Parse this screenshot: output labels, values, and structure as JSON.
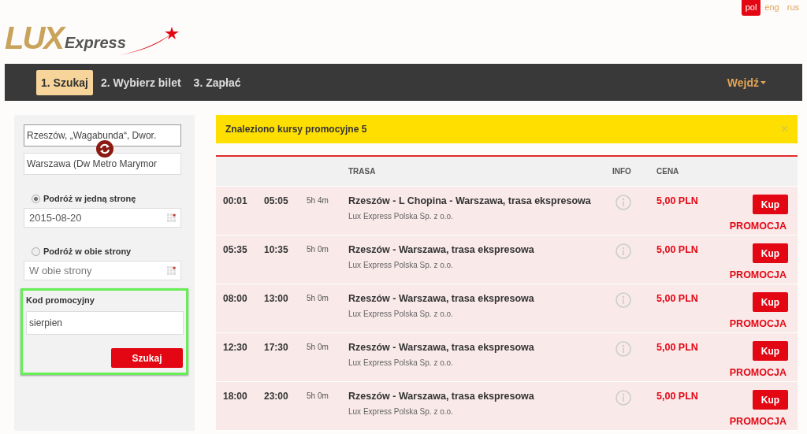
{
  "languages": [
    {
      "label": "pol",
      "selected": true
    },
    {
      "label": "eng",
      "selected": false
    },
    {
      "label": "rus",
      "selected": false
    }
  ],
  "logo": {
    "word": "LUX",
    "subword": "Express"
  },
  "steps": [
    {
      "label": "1. Szukaj",
      "selected": true
    },
    {
      "label": "2. Wybierz bilet",
      "selected": false
    },
    {
      "label": "3. Zapłać",
      "selected": false
    }
  ],
  "login": {
    "label": "Wejdź"
  },
  "search": {
    "from": "Rzeszów, „Wagabunda“, Dwor.",
    "to": "Warszawa (Dw Metro Marymor",
    "trip_types": [
      {
        "label": "Podróż w jedną stronę",
        "selected": true,
        "date_value": "2015-08-20"
      },
      {
        "label": "Podróż w obie strony",
        "selected": false,
        "date_placeholder": "W obie strony"
      }
    ],
    "promo": {
      "label": "Kod promocyjny",
      "value": "sierpien"
    },
    "button": "Szukaj"
  },
  "alert": {
    "text": "Znaleziono kursy promocyjne 5",
    "close": "×"
  },
  "table": {
    "columns": [
      "TRASA",
      "INFO",
      "CENA"
    ],
    "rows": [
      {
        "departure": "00:01",
        "arrival": "05:05",
        "duration": "5h 4m",
        "route": "Rzeszów - L Chopina - Warszawa, trasa ekspresowa",
        "operator": "Lux Express Polska Sp. z o.o.",
        "price": "5,00 PLN",
        "button": "Kup",
        "tag": "PROMOCJA"
      },
      {
        "departure": "05:35",
        "arrival": "10:35",
        "duration": "5h 0m",
        "route": "Rzeszów - Warszawa, trasa ekspresowa",
        "operator": "Lux Express Polska Sp. z o.o.",
        "price": "5,00 PLN",
        "button": "Kup",
        "tag": "PROMOCJA"
      },
      {
        "departure": "08:00",
        "arrival": "13:00",
        "duration": "5h 0m",
        "route": "Rzeszów - Warszawa, trasa ekspresowa",
        "operator": "Lux Express Polska Sp. z o.o.",
        "price": "5,00 PLN",
        "button": "Kup",
        "tag": "PROMOCJA"
      },
      {
        "departure": "12:30",
        "arrival": "17:30",
        "duration": "5h 0m",
        "route": "Rzeszów - Warszawa, trasa ekspresowa",
        "operator": "Lux Express Polska Sp. z o.o.",
        "price": "5,00 PLN",
        "button": "Kup",
        "tag": "PROMOCJA"
      },
      {
        "departure": "18:00",
        "arrival": "23:00",
        "duration": "5h 0m",
        "route": "Rzeszów - Warszawa, trasa ekspresowa",
        "operator": "Lux Express Polska Sp. z o.o.",
        "price": "5,00 PLN",
        "button": "Kup",
        "tag": "PROMOCJA"
      }
    ]
  }
}
